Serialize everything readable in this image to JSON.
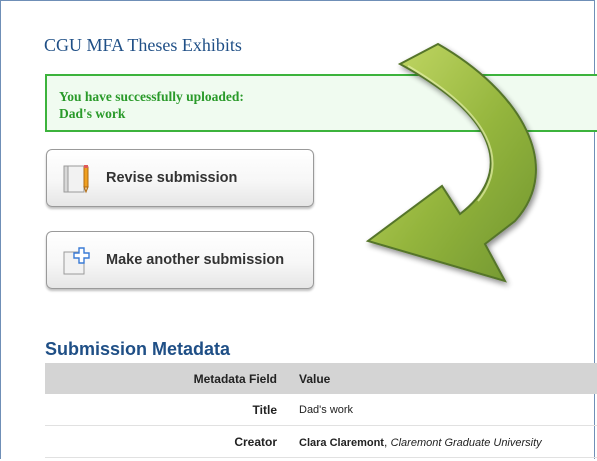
{
  "page": {
    "title": "CGU MFA Theses Exhibits"
  },
  "success": {
    "line1": "You have successfully uploaded:",
    "line2": "Dad's work"
  },
  "buttons": {
    "revise": "Revise submission",
    "another": "Make another submission"
  },
  "metadata": {
    "heading": "Submission Metadata",
    "columns": [
      "Metadata Field",
      "Value"
    ],
    "rows": [
      {
        "field": "Title",
        "value": "Dad's work"
      },
      {
        "field": "Creator",
        "name": "Clara Claremont",
        "separator": ", ",
        "affiliation": "Claremont Graduate University"
      }
    ]
  },
  "icons": {
    "revise": "notebook-pencil-icon",
    "another": "document-add-icon",
    "overlay": "curved-arrow-icon"
  },
  "colors": {
    "title": "#1f4f86",
    "success_border": "#3cb33c",
    "success_text": "#2a9a2a",
    "arrow_green": "#8fb23a",
    "table_header": "#d4d4d4"
  }
}
